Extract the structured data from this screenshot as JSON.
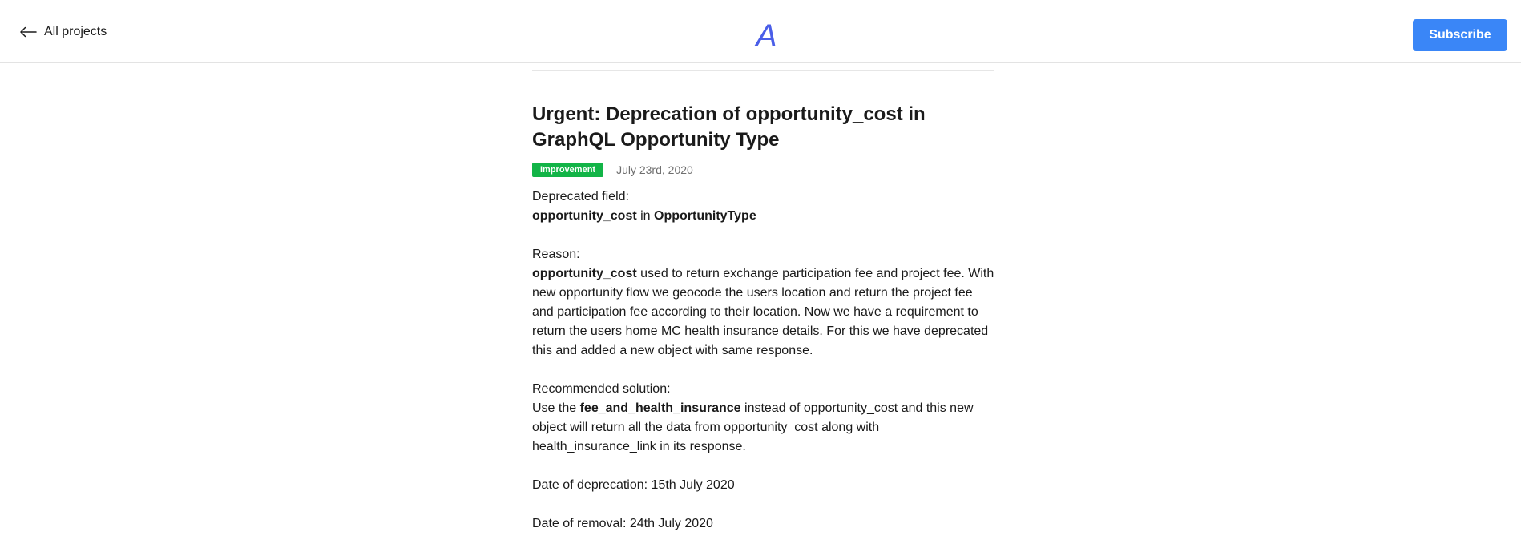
{
  "header": {
    "back_label": "All projects",
    "logo_letter": "A",
    "subscribe_label": "Subscribe"
  },
  "colors": {
    "accent": "#3a86f7",
    "badge": "#12b447",
    "logo": "#4a5ee8"
  },
  "icons": {
    "back": "arrow-left-icon"
  },
  "article": {
    "title": "Urgent: Deprecation of opportunity_cost in GraphQL Opportunity Type",
    "badge": "Improvement",
    "date": "July 23rd, 2020",
    "deprecated_heading": "Deprecated field:",
    "deprecated_field": "opportunity_cost",
    "deprecated_in": " in ",
    "deprecated_type": "OpportunityType",
    "reason_heading": "Reason:",
    "reason_field": "opportunity_cost",
    "reason_text": " used to return exchange participation fee and project fee. With new opportunity flow we geocode the users location and return the project fee and participation fee according to their location. Now we have a requirement to return the users home MC health insurance details.  For this we have deprecated this and added a new object with same response.",
    "solution_heading": "Recommended solution:",
    "solution_prefix": "Use the ",
    "solution_field": "fee_and_health_insurance",
    "solution_text": " instead of opportunity_cost and this new object will return all the data from opportunity_cost along with health_insurance_link in its response.",
    "deprecation_date": "Date of deprecation: 15th July 2020",
    "removal_date": "Date of removal: 24th July 2020"
  }
}
